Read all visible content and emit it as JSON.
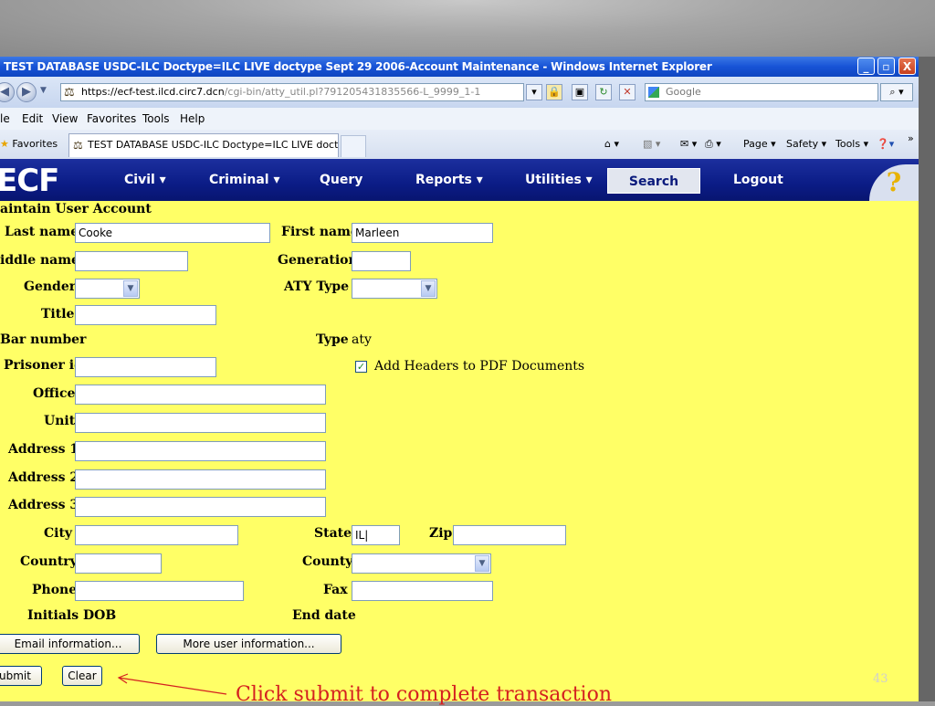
{
  "window": {
    "title": "TEST DATABASE USDC-ILC Doctype=ILC LIVE doctype Sept 29 2006-Account Maintenance - Windows Internet Explorer",
    "min": "_",
    "max": "▫",
    "close": "X"
  },
  "address": {
    "url_prefix": "https://",
    "url_host": "ecf-test.ilcd.circ7.dcn",
    "url_rest": "/cgi-bin/atty_util.pl?791205431835566-L_9999_1-1",
    "search_placeholder": "Google"
  },
  "menu": {
    "file": "le",
    "edit": "Edit",
    "view": "View",
    "favorites": "Favorites",
    "tools": "Tools",
    "help": "Help"
  },
  "tabs": {
    "favorites": "Favorites",
    "active_tab": "TEST DATABASE USDC-ILC Doctype=ILC LIVE doctyp...",
    "page": "Page",
    "safety": "Safety",
    "tools": "Tools"
  },
  "ecf_nav": {
    "logo": "ECF",
    "items": [
      "Civil",
      "Criminal",
      "Query",
      "Reports",
      "Utilities",
      "Search",
      "Logout"
    ],
    "help": "?"
  },
  "form": {
    "heading": "aintain User Account",
    "last_name_label": "Last name",
    "last_name_value": "Cooke",
    "first_name_label": "First name",
    "first_name_value": "Marleen",
    "middle_name_label": "iddle name",
    "generation_label": "Generation",
    "gender_label": "Gender",
    "aty_type_label": "ATY Type",
    "title_label": "Title",
    "bar_number_label": "Bar number",
    "type_label": "Type",
    "type_value": "aty",
    "prisoner_id_label": "Prisoner id",
    "add_headers_label": "Add Headers to PDF Documents",
    "office_label": "Office",
    "unit_label": "Unit",
    "address1_label": "Address 1",
    "address2_label": "Address 2",
    "address3_label": "Address 3",
    "city_label": "City",
    "state_label": "State",
    "state_value": "IL",
    "zip_label": "Zip",
    "country_label": "Country",
    "county_label": "County",
    "phone_label": "Phone",
    "fax_label": "Fax",
    "initials_label": "Initials",
    "dob_label": "DOB",
    "end_date_label": "End date",
    "email_info_button": "Email information...",
    "more_user_info_button": "More user information...",
    "submit_button": "ubmit",
    "clear_button": "Clear"
  },
  "annotation": "Click submit to complete transaction",
  "page_number": "43",
  "colors": {
    "form_bg": "#ffff66",
    "nav_bg": "#0b1c86",
    "annotation": "#d42020"
  }
}
